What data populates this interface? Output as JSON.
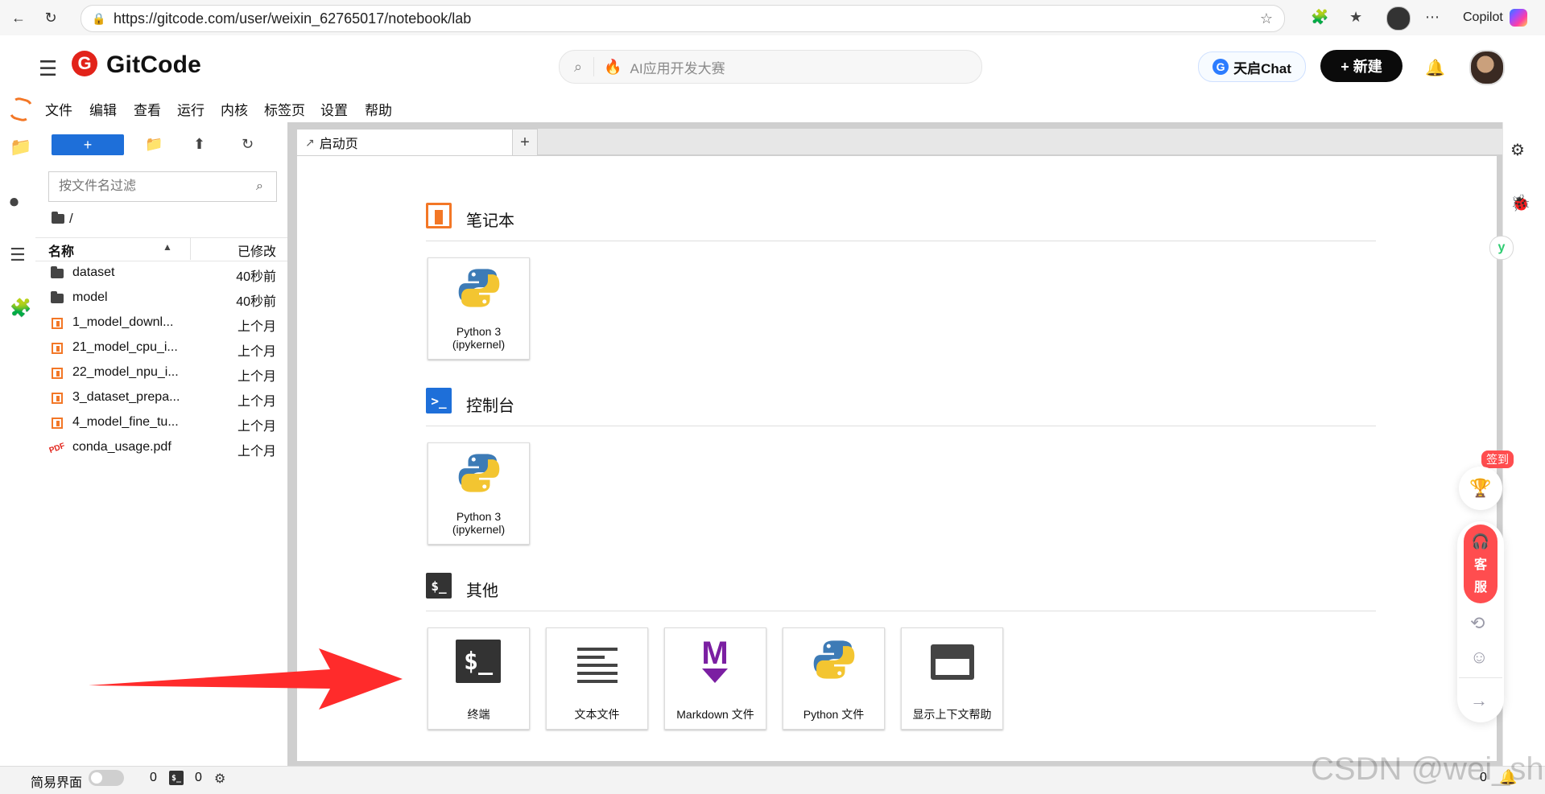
{
  "browser": {
    "url": "https://gitcode.com/user/weixin_62765017/notebook/lab",
    "copilot_label": "Copilot"
  },
  "gitcode": {
    "brand": "GitCode",
    "search_text": "AI应用开发大赛",
    "chat_button": "天启Chat",
    "new_button": "+ 新建"
  },
  "jupyter": {
    "menu": [
      "文件",
      "编辑",
      "查看",
      "运行",
      "内核",
      "标签页",
      "设置",
      "帮助"
    ],
    "file_browser": {
      "filter_placeholder": "按文件名过滤",
      "breadcrumb": "/",
      "columns": {
        "name": "名称",
        "modified": "已修改"
      },
      "items": [
        {
          "type": "folder",
          "name": "dataset",
          "modified": "40秒前"
        },
        {
          "type": "folder",
          "name": "model",
          "modified": "40秒前"
        },
        {
          "type": "notebook",
          "name": "1_model_downl...",
          "modified": "上个月"
        },
        {
          "type": "notebook",
          "name": "21_model_cpu_i...",
          "modified": "上个月"
        },
        {
          "type": "notebook",
          "name": "22_model_npu_i...",
          "modified": "上个月"
        },
        {
          "type": "notebook",
          "name": "3_dataset_prepa...",
          "modified": "上个月"
        },
        {
          "type": "notebook",
          "name": "4_model_fine_tu...",
          "modified": "上个月"
        },
        {
          "type": "pdf",
          "name": "conda_usage.pdf",
          "modified": "上个月"
        }
      ]
    },
    "tabs": [
      {
        "label": "启动页"
      }
    ],
    "launcher": {
      "sections": [
        {
          "title": "笔记本",
          "cards": [
            {
              "label_line1": "Python 3",
              "label_line2": "(ipykernel)"
            }
          ]
        },
        {
          "title": "控制台",
          "cards": [
            {
              "label_line1": "Python 3",
              "label_line2": "(ipykernel)"
            }
          ]
        },
        {
          "title": "其他",
          "cards": [
            {
              "label": "终端"
            },
            {
              "label": "文本文件"
            },
            {
              "label": "Markdown 文件"
            },
            {
              "label": "Python 文件"
            },
            {
              "label": "显示上下文帮助"
            }
          ]
        }
      ]
    },
    "status_bar": {
      "simple_ui_label": "简易界面",
      "terminals_count": "0",
      "kernels_count": "0",
      "right_count": "0"
    }
  },
  "floating": {
    "signin": "签到",
    "service_line1": "客",
    "service_line2": "服"
  },
  "watermark": "CSDN @wei_shuo",
  "colors": {
    "primary_blue": "#1e6fd9",
    "jupyter_orange": "#f37726",
    "gitcode_red": "#e2231a",
    "alert_red": "#ff4d4f"
  },
  "icons": {
    "browser_back": "arrow-left-icon",
    "browser_reload": "refresh-icon",
    "search": "search-icon"
  }
}
